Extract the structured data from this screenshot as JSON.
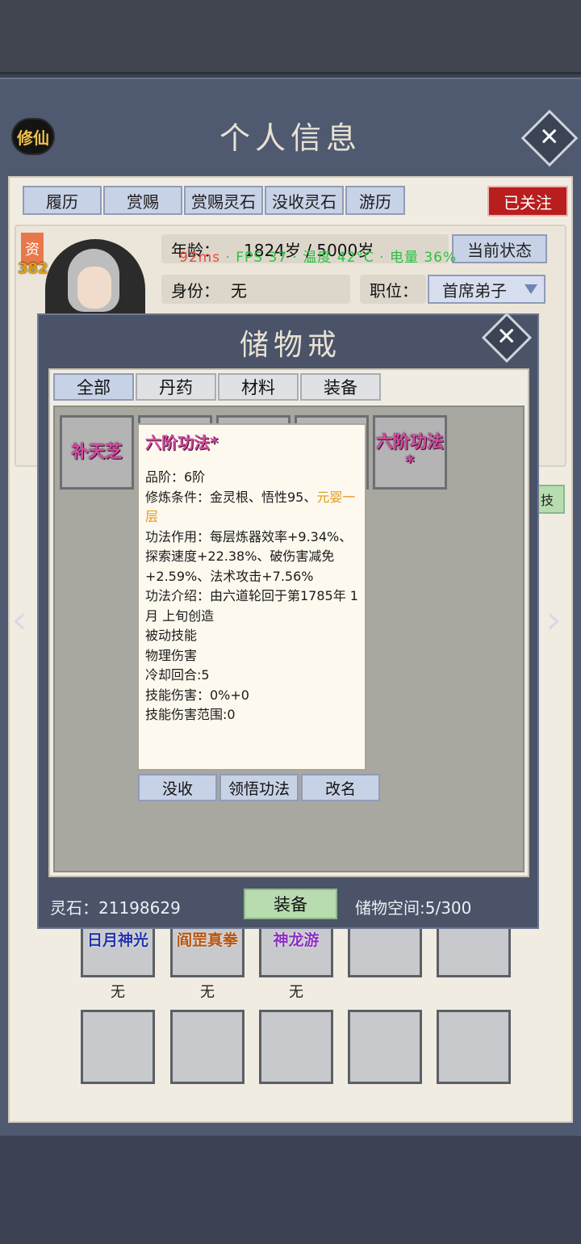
{
  "header": {
    "badge": "修仙",
    "title": "个人信息",
    "close_label": "✕"
  },
  "tabs": [
    "履历",
    "赏赐",
    "赏赐灵石",
    "没收灵石",
    "游历"
  ],
  "follow_label": "已关注",
  "profile": {
    "zi_label": "资",
    "zi_value": "382",
    "age_label": "年龄：",
    "age_value": "1824岁 / 5000岁",
    "status_button": "当前状态",
    "identity_label": "身份：",
    "identity_value": "无",
    "post_label": "职位：",
    "post_value": "首席弟子"
  },
  "fps_overlay": {
    "latency": "92ms",
    "fps": "· FPS 37 · 温度 42°C · 电量 36%"
  },
  "side_button": "技",
  "skills": {
    "row1": [
      {
        "name": "日月神光",
        "color": "#2233aa",
        "label": "无"
      },
      {
        "name": "阎罡真拳",
        "color": "#b5540e",
        "label": "无"
      },
      {
        "name": "神龙游",
        "color": "#8a2fc0",
        "label": "无"
      },
      {
        "name": "",
        "color": "#222222",
        "label": ""
      },
      {
        "name": "",
        "color": "#222222",
        "label": ""
      }
    ]
  },
  "inventory": {
    "title": "储物戒",
    "close_label": "✕",
    "tabs": [
      "全部",
      "丹药",
      "材料",
      "装备"
    ],
    "items": [
      "补天芝",
      "",
      "",
      "",
      "六阶功法\n*"
    ],
    "tooltip": {
      "title": "六阶功法*",
      "line1": "品阶：6阶",
      "line2_a": "修炼条件：金灵根、悟性95、",
      "line2_b": "元婴一层",
      "body": "功法作用：每层炼器效率+9.34%、探索速度+22.38%、破伤害减免+2.59%、法术攻击+7.56%\n功法介绍：由六道轮回于第1785年 1月 上旬创造\n被动技能\n物理伤害\n冷却回合:5\n技能伤害：0%+0\n技能伤害范围:0"
    },
    "actions": [
      "没收",
      "领悟功法",
      "改名"
    ],
    "lingshi": "灵石：21198629",
    "equip_button": "装备",
    "space": "储物空间:5/300"
  },
  "nav": {
    "left": "‹",
    "right": "›"
  },
  "colors": {
    "frame": "#4f5970",
    "paper": "#f1ece2",
    "tab": "#c8d2e6",
    "accent_red": "#b81e1e",
    "item_pink": "#d64aa0"
  }
}
